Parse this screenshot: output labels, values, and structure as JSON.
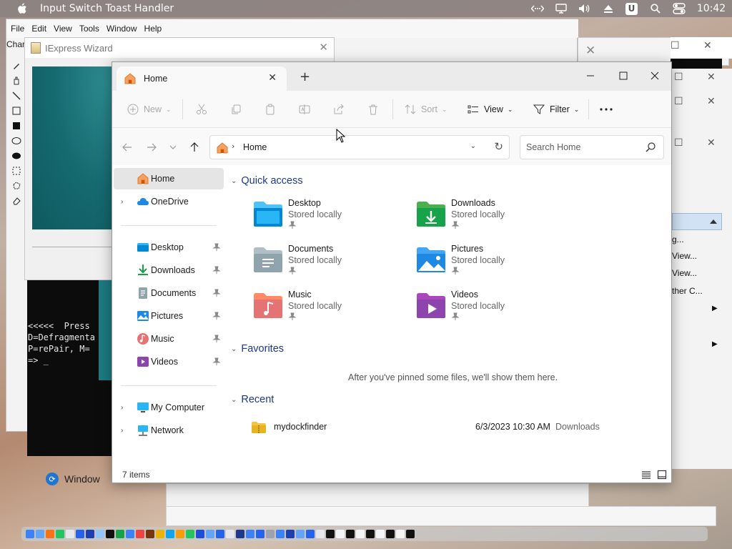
{
  "menubar": {
    "app_title": "Input Switch Toast Handler",
    "u_badge": "U",
    "clock": "10:42"
  },
  "paint": {
    "menus": [
      "File",
      "Edit",
      "View",
      "Tools",
      "Window",
      "Help"
    ],
    "char_label": "Char"
  },
  "iexpress": {
    "title": "IExpress Wizard"
  },
  "console": {
    "lines": [
      "<<<<<  Press",
      "D=Defragmenta",
      "P=rePair, M=",
      "=> _"
    ]
  },
  "right_panel": {
    "items": [
      "g...",
      "View...",
      "View...",
      "ther C..."
    ]
  },
  "taskbar_item": "Window",
  "explorer": {
    "tab_label": "Home",
    "commands": {
      "new": "New",
      "sort": "Sort",
      "view": "View",
      "filter": "Filter"
    },
    "address": {
      "path": "Home"
    },
    "search": {
      "placeholder": "Search Home"
    },
    "sidebar": {
      "items": [
        {
          "label": "Home",
          "icon": "home-icon"
        },
        {
          "label": "OneDrive",
          "icon": "cloud-icon"
        },
        {
          "label": "Desktop",
          "icon": "desktop-folder-icon"
        },
        {
          "label": "Downloads",
          "icon": "download-icon"
        },
        {
          "label": "Documents",
          "icon": "documents-icon"
        },
        {
          "label": "Pictures",
          "icon": "pictures-icon"
        },
        {
          "label": "Music",
          "icon": "music-icon"
        },
        {
          "label": "Videos",
          "icon": "videos-icon"
        },
        {
          "label": "My Computer",
          "icon": "computer-icon"
        },
        {
          "label": "Network",
          "icon": "network-icon"
        }
      ]
    },
    "quick_access": {
      "heading": "Quick access",
      "tiles": [
        {
          "name": "Desktop",
          "sub": "Stored locally"
        },
        {
          "name": "Downloads",
          "sub": "Stored locally"
        },
        {
          "name": "Documents",
          "sub": "Stored locally"
        },
        {
          "name": "Pictures",
          "sub": "Stored locally"
        },
        {
          "name": "Music",
          "sub": "Stored locally"
        },
        {
          "name": "Videos",
          "sub": "Stored locally"
        }
      ]
    },
    "favorites": {
      "heading": "Favorites",
      "empty_text": "After you've pinned some files, we'll show them here."
    },
    "recent": {
      "heading": "Recent",
      "items": [
        {
          "name": "mydockfinder",
          "date": "6/3/2023 10:30 AM",
          "location": "Downloads"
        }
      ]
    },
    "status": {
      "count": "7 items"
    }
  },
  "colors": {
    "accent": "#1b3a8c",
    "selection": "#e5e5e5",
    "folder_blue": "#1e88e5",
    "folder_green": "#16a34a"
  }
}
